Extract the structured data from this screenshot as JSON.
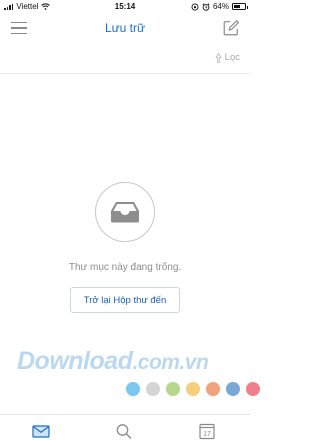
{
  "status_bar": {
    "carrier": "Viettel",
    "time": "15:14",
    "battery": "64%",
    "battery_level": 0.64
  },
  "header": {
    "title": "Lưu trữ",
    "menu_icon": "hamburger-menu-icon",
    "compose_icon": "compose-icon"
  },
  "filter": {
    "label": "Lọc",
    "icon": "filter-icon"
  },
  "empty_state": {
    "icon": "inbox-tray-icon",
    "message": "Thư mục này đang trống.",
    "button_label": "Trở lại Hộp thư đến"
  },
  "watermark": {
    "brand": "Download",
    "suffix": ".com.vn",
    "dot_colors": [
      "#7cc7f0",
      "#d4d4d4",
      "#b5d88a",
      "#f5cf7e",
      "#f0a27d",
      "#7aa7d6",
      "#ef7f8c"
    ]
  },
  "tabbar": {
    "tabs": [
      {
        "name": "mail",
        "icon": "mail-icon",
        "active": true
      },
      {
        "name": "search",
        "icon": "search-icon",
        "active": false
      },
      {
        "name": "calendar",
        "icon": "calendar-icon",
        "day": "17",
        "active": false
      }
    ]
  },
  "colors": {
    "accent": "#1a6fc4",
    "muted": "#8e8e8e"
  }
}
